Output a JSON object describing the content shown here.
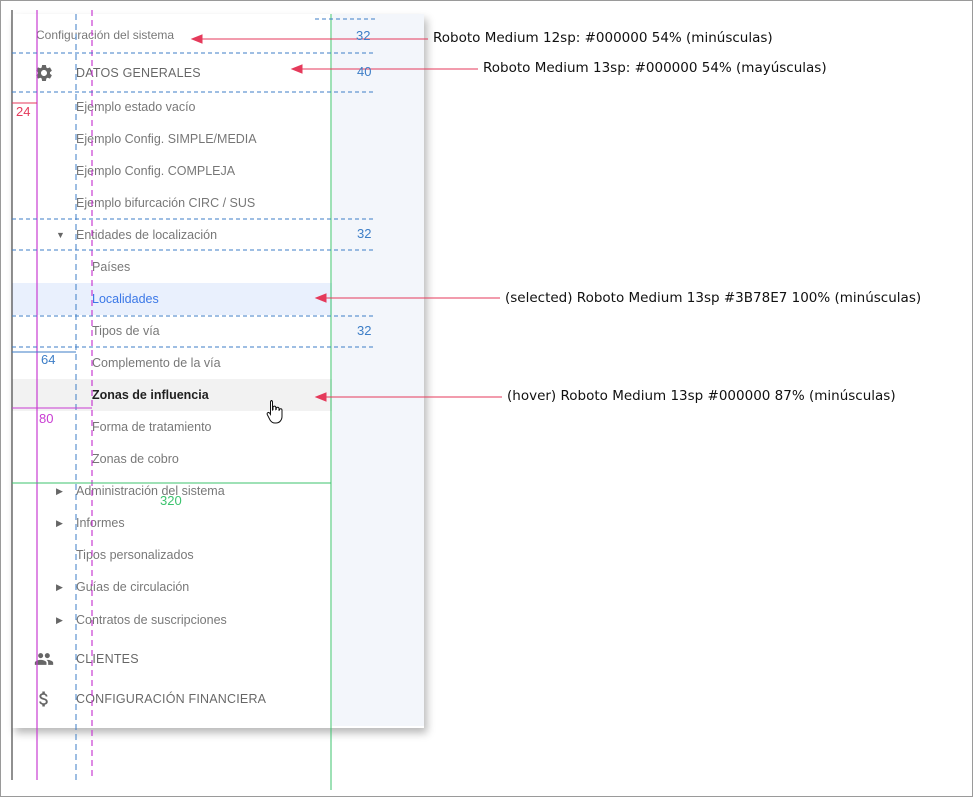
{
  "nav": {
    "section_header": "Configuración del sistema",
    "datos_generales": {
      "label": "DATOS GENERALES",
      "icon": "gear-icon",
      "items": [
        "Ejemplo estado vacío",
        "Ejemplo Config. SIMPLE/MEDIA",
        "Ejemplo Config. COMPLEJA",
        "Ejemplo bifurcación CIRC / SUS"
      ],
      "group": {
        "label": "Entidades de localización",
        "children": [
          "Países",
          "Localidades",
          "Tipos de vía",
          "Complemento de la vía",
          "Zonas de influencia",
          "Forma de tratamiento",
          "Zonas de cobro"
        ]
      },
      "collapsed_items": [
        "Administración del sistema",
        "Informes",
        "Tipos personalizados",
        "Guías de circulación",
        "Contratos de suscripciones"
      ]
    },
    "clientes": {
      "label": "CLIENTES",
      "icon": "people-icon"
    },
    "financiera": {
      "label": "CONFIGURACIÓN FINANCIERA",
      "icon": "dollar-icon"
    }
  },
  "dimensions": {
    "h32a": "32",
    "h40": "40",
    "h32b": "32",
    "h32c": "32",
    "w24": "24",
    "w64": "64",
    "w80": "80",
    "w320": "320"
  },
  "annotations": {
    "header_style": "Roboto Medium 12sp: #000000 54% (minúsculas)",
    "section_style": "Roboto Medium 13sp: #000000 54% (mayúsculas)",
    "selected_style": "(selected) Roboto Medium 13sp #3B78E7 100% (minúsculas)",
    "hover_style": "(hover) Roboto Medium 13sp #000000 87% (minúsculas)"
  },
  "colors": {
    "selected_text": "#3B78E7",
    "selected_bg": "#E9F0FD",
    "hover_bg": "#F2F2F2",
    "annotation_arrow": "#E53A5B",
    "guide_blue": "#3D7EC7",
    "guide_magenta": "#C83CD2",
    "guide_green": "#3CC36E"
  }
}
